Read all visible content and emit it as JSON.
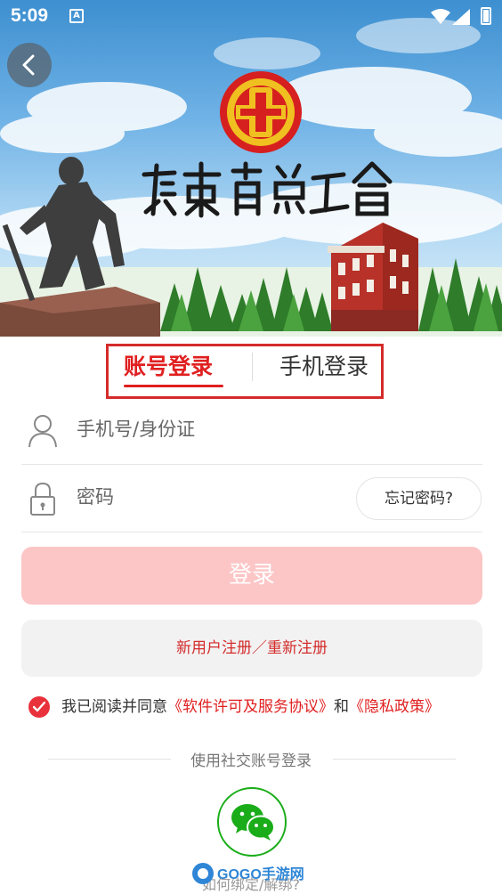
{
  "status_bar": {
    "time": "5:09",
    "notification_letter": "A"
  },
  "header": {
    "back_icon": "chevron-left-icon"
  },
  "tabs": [
    {
      "label": "账号登录",
      "active": true
    },
    {
      "label": "手机登录",
      "active": false
    }
  ],
  "form": {
    "account_placeholder": "手机号/身份证",
    "account_value": "",
    "password_placeholder": "密码",
    "password_value": "",
    "forgot_label": "忘记密码?"
  },
  "buttons": {
    "login_label": "登录",
    "register_label": "新用户注册／重新注册"
  },
  "agreement": {
    "checked": true,
    "prefix": "我已阅读并同意",
    "license_link": "《软件许可及服务协议》",
    "and": "和",
    "privacy_link": "《隐私政策》"
  },
  "social": {
    "title": "使用社交账号登录",
    "wechat_icon": "wechat-icon",
    "unbind_label": "如何绑定/解绑?"
  },
  "watermark": {
    "text": "GOGO手游网"
  },
  "colors": {
    "accent_red": "#e02020",
    "login_button_bg": "#fcc6c7",
    "register_bg": "#f2f2f2",
    "wechat_green": "#1aad19"
  }
}
